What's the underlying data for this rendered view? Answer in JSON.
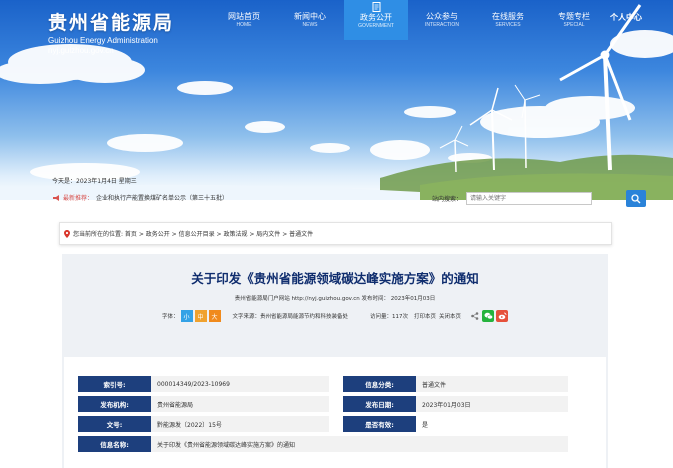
{
  "header": {
    "logo_cn": "贵州省能源局",
    "logo_en": "Guizhou Energy Administration",
    "logo_url": "nyj.guizhou.gov.cn",
    "nav": [
      {
        "cn": "网站首页",
        "en": "HOME"
      },
      {
        "cn": "新闻中心",
        "en": "NEWS"
      },
      {
        "cn": "政务公开",
        "en": "GOVERNMENT",
        "active": true,
        "icon": "document-icon"
      },
      {
        "cn": "公众参与",
        "en": "INTERACTION"
      },
      {
        "cn": "在线服务",
        "en": "SERVICES"
      },
      {
        "cn": "专题专栏",
        "en": "SPECIAL"
      }
    ],
    "personal": "个人中心"
  },
  "infobar": {
    "date": "今天是：2023年1月4日 星期三",
    "notice_tag": "最新推荐：",
    "notice_text": "企业和执行产能置换煤矿名单公示（第三十五批）",
    "search_label": "站内搜索：",
    "search_placeholder": "请输入关键字"
  },
  "breadcrumb": "您当前所在的位置: 首页 > 政务公开 > 信息公开目录 > 政策法规 > 局内文件 > 普通文件",
  "article": {
    "title": "关于印发《贵州省能源领域碳达峰实施方案》的通知",
    "source": "贵州省能源局门户网站   http://nyj.guizhou.gov.cn   发布时间： 2023年01月03日",
    "font_label": "字体：",
    "font_sizes": [
      "小",
      "中",
      "大"
    ],
    "text_source": "文字来源：贵州省能源局能源节约和科技装备处",
    "visits": "访问量：117次",
    "print": "打印本页",
    "close": "关闭本页",
    "meta": [
      {
        "k1": "索引号:",
        "v1": "000014349/2023-10969",
        "k2": "信息分类:",
        "v2": "普通文件"
      },
      {
        "k1": "发布机构:",
        "v1": "贵州省能源局",
        "k2": "发布日期:",
        "v2": "2023年01月03日"
      },
      {
        "k1": "文号:",
        "v1": "黔能源发〔2022〕15号",
        "k2": "是否有效:",
        "v2": "是"
      },
      {
        "k1": "信息名称:",
        "v1": "关于印发《贵州省能源领域碳达峰实施方案》的通知"
      }
    ]
  },
  "colors": {
    "nav_active": "#2f8ee5",
    "title": "#0f2d6e",
    "meta_key_bg": "#1d3f7d",
    "search_button": "#2a83d9"
  }
}
